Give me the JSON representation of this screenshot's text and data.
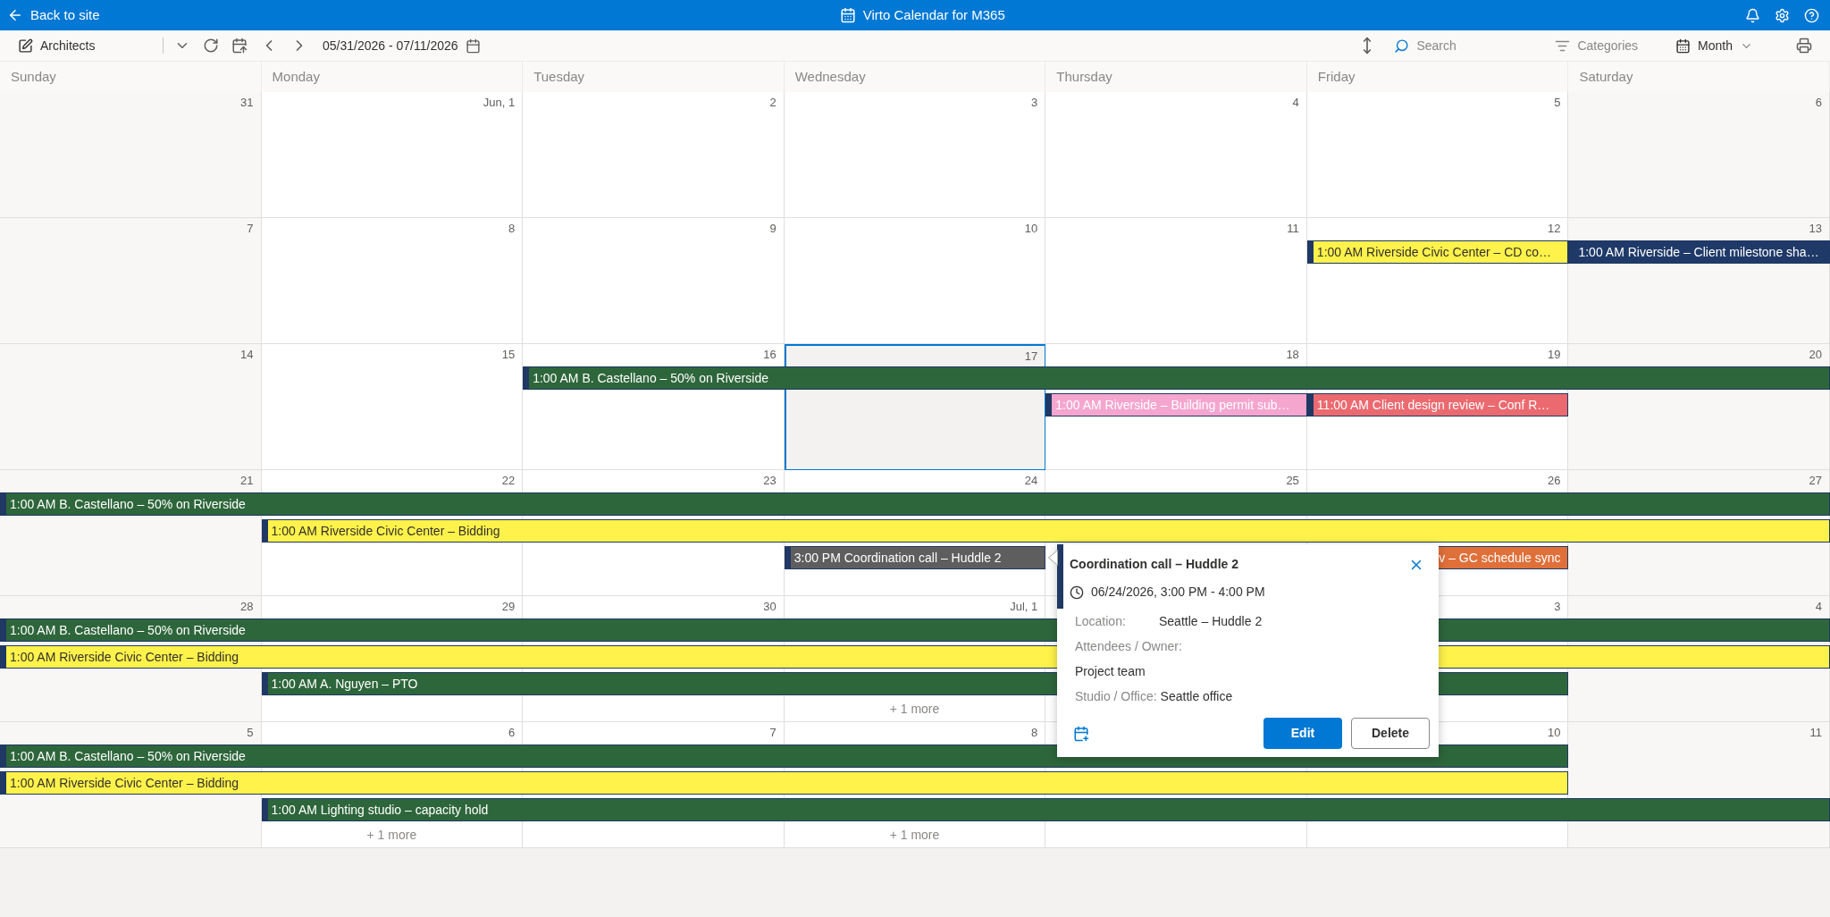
{
  "top_bar": {
    "back_link": "Back to site",
    "title": "Virto Calendar for M365"
  },
  "toolbar": {
    "calendar_name": "Architects",
    "date_range": "05/31/2026 - 07/11/2026",
    "search": {
      "placeholder": "Search"
    },
    "categories": "Categories",
    "view": "Month"
  },
  "weekdays": [
    "Sunday",
    "Monday",
    "Tuesday",
    "Wednesday",
    "Thursday",
    "Friday",
    "Saturday"
  ],
  "weeks": [
    {
      "days": [
        {
          "date": "31",
          "selected": false
        },
        {
          "date": "Jun, 1",
          "selected": false
        },
        {
          "date": "2",
          "selected": false
        },
        {
          "date": "3",
          "selected": false
        },
        {
          "date": "4",
          "selected": false
        },
        {
          "date": "5",
          "selected": false
        },
        {
          "date": "6",
          "selected": false
        }
      ]
    },
    {
      "days": [
        {
          "date": "7",
          "selected": false
        },
        {
          "date": "8",
          "selected": false
        },
        {
          "date": "9",
          "selected": false
        },
        {
          "date": "10",
          "selected": false
        },
        {
          "date": "11",
          "selected": false
        },
        {
          "date": "12",
          "selected": false
        },
        {
          "date": "13",
          "selected": false
        }
      ],
      "lanes": [
        [
          {
            "kind": "gap"
          },
          {
            "kind": "gap"
          },
          {
            "kind": "gap"
          },
          {
            "kind": "gap"
          },
          {
            "kind": "gap"
          },
          {
            "kind": "start",
            "text": "1:00 AM Riverside Civic Center – CD co…",
            "color": "#fff24a"
          },
          {
            "kind": "start",
            "text": "1:00 AM Riverside – Client milestone sha…",
            "color": "#1f3a68"
          }
        ]
      ]
    },
    {
      "days": [
        {
          "date": "14",
          "selected": false
        },
        {
          "date": "15",
          "selected": false
        },
        {
          "date": "16",
          "selected": false
        },
        {
          "date": "17",
          "selected": true
        },
        {
          "date": "18",
          "selected": false
        },
        {
          "date": "19",
          "selected": false
        },
        {
          "date": "20",
          "selected": false
        }
      ],
      "lanes": [
        [
          {
            "kind": "gap"
          },
          {
            "kind": "gap"
          },
          {
            "kind": "start",
            "text": "1:00 AM B. Castellano – 50% on Riverside",
            "color": "#2e663b"
          },
          {
            "kind": "continue"
          },
          {
            "kind": "continue"
          },
          {
            "kind": "continue"
          },
          {
            "kind": "continue"
          }
        ],
        [
          {
            "kind": "gap"
          },
          {
            "kind": "gap"
          },
          {
            "kind": "gap"
          },
          {
            "kind": "gap"
          },
          {
            "kind": "start",
            "text": "1:00 AM Riverside – Building permit sub…",
            "color": "#f4a6cf"
          },
          {
            "kind": "start",
            "text": "11:00 AM Client design review – Conf R…",
            "color": "#eb6a70"
          },
          {
            "kind": "gap"
          }
        ]
      ]
    },
    {
      "days": [
        {
          "date": "21",
          "selected": false
        },
        {
          "date": "22",
          "selected": false
        },
        {
          "date": "23",
          "selected": false
        },
        {
          "date": "24",
          "selected": false
        },
        {
          "date": "25",
          "selected": false
        },
        {
          "date": "26",
          "selected": false
        },
        {
          "date": "27",
          "selected": false
        }
      ],
      "lanes": [
        [
          {
            "kind": "start",
            "text": "1:00 AM B. Castellano – 50% on Riverside",
            "color": "#2e663b"
          },
          {
            "kind": "continue"
          },
          {
            "kind": "continue"
          },
          {
            "kind": "continue"
          },
          {
            "kind": "continue"
          },
          {
            "kind": "continue"
          },
          {
            "kind": "continue"
          }
        ],
        [
          {
            "kind": "gap"
          },
          {
            "kind": "start",
            "text": "1:00 AM Riverside Civic Center – Bidding",
            "color": "#fff24a"
          },
          {
            "kind": "continue"
          },
          {
            "kind": "continue"
          },
          {
            "kind": "continue"
          },
          {
            "kind": "continue"
          },
          {
            "kind": "continue"
          }
        ],
        [
          {
            "kind": "gap"
          },
          {
            "kind": "gap"
          },
          {
            "kind": "gap"
          },
          {
            "kind": "start",
            "text": "3:00 PM Coordination call – Huddle 2",
            "color": "#5e5e5e"
          },
          {
            "kind": "gap"
          },
          {
            "kind": "partial",
            "text": "v – GC schedule sync",
            "color": "#e0703a"
          },
          {
            "kind": "gap"
          }
        ]
      ]
    },
    {
      "days": [
        {
          "date": "28",
          "selected": false
        },
        {
          "date": "29",
          "selected": false
        },
        {
          "date": "30",
          "selected": false
        },
        {
          "date": "Jul, 1",
          "selected": false,
          "more": "+ 1 more"
        },
        {
          "selected": false
        },
        {
          "date": "3",
          "selected": false
        },
        {
          "date": "4",
          "selected": false
        }
      ],
      "lanes": [
        [
          {
            "kind": "start",
            "text": "1:00 AM B. Castellano – 50% on Riverside",
            "color": "#2e663b"
          },
          {
            "kind": "continue"
          },
          {
            "kind": "continue"
          },
          {
            "kind": "continue"
          },
          {
            "kind": "continue"
          },
          {
            "kind": "continue"
          },
          {
            "kind": "continue"
          }
        ],
        [
          {
            "kind": "start",
            "text": "1:00 AM Riverside Civic Center – Bidding",
            "color": "#fff24a"
          },
          {
            "kind": "continue"
          },
          {
            "kind": "continue"
          },
          {
            "kind": "continue"
          },
          {
            "kind": "continue"
          },
          {
            "kind": "continue"
          },
          {
            "kind": "continue"
          }
        ],
        [
          {
            "kind": "gap"
          },
          {
            "kind": "start",
            "text": "1:00 AM A. Nguyen – PTO",
            "color": "#2e663b"
          },
          {
            "kind": "continue"
          },
          {
            "kind": "continue"
          },
          {
            "kind": "continue"
          },
          {
            "kind": "continue"
          },
          {
            "kind": "gap"
          }
        ]
      ]
    },
    {
      "days": [
        {
          "date": "5",
          "selected": false
        },
        {
          "date": "6",
          "selected": false,
          "more": "+ 1 more"
        },
        {
          "date": "7",
          "selected": false
        },
        {
          "date": "8",
          "selected": false,
          "more": "+ 1 more"
        },
        {
          "selected": false
        },
        {
          "date": "10",
          "selected": false
        },
        {
          "date": "11",
          "selected": false
        }
      ],
      "lanes": [
        [
          {
            "kind": "start",
            "text": "1:00 AM B. Castellano – 50% on Riverside",
            "color": "#2e663b"
          },
          {
            "kind": "continue"
          },
          {
            "kind": "continue"
          },
          {
            "kind": "continue"
          },
          {
            "kind": "continue"
          },
          {
            "kind": "continue"
          },
          {
            "kind": "gap"
          }
        ],
        [
          {
            "kind": "start",
            "text": "1:00 AM Riverside Civic Center – Bidding",
            "color": "#fff24a"
          },
          {
            "kind": "continue"
          },
          {
            "kind": "continue"
          },
          {
            "kind": "continue"
          },
          {
            "kind": "continue"
          },
          {
            "kind": "continue"
          },
          {
            "kind": "gap"
          }
        ],
        [
          {
            "kind": "gap"
          },
          {
            "kind": "start",
            "text": "1:00 AM Lighting studio – capacity hold",
            "color": "#2e663b"
          },
          {
            "kind": "continue"
          },
          {
            "kind": "continue"
          },
          {
            "kind": "continue"
          },
          {
            "kind": "continue"
          },
          {
            "kind": "continue"
          }
        ]
      ]
    }
  ],
  "popup": {
    "title": "Coordination call – Huddle 2",
    "datetime": "06/24/2026, 3:00 PM - 4:00 PM",
    "fields": [
      {
        "kind": "inline",
        "label": "Location:",
        "value": "Seattle – Huddle 2"
      },
      {
        "kind": "stacked",
        "label": "Attendees / Owner:",
        "value": "Project team"
      },
      {
        "kind": "inline",
        "label": "Studio / Office:",
        "value": "Seattle office"
      }
    ],
    "buttons": [
      {
        "kind": "primary",
        "label": "Edit"
      },
      {
        "kind": "secondary",
        "label": "Delete"
      }
    ]
  }
}
